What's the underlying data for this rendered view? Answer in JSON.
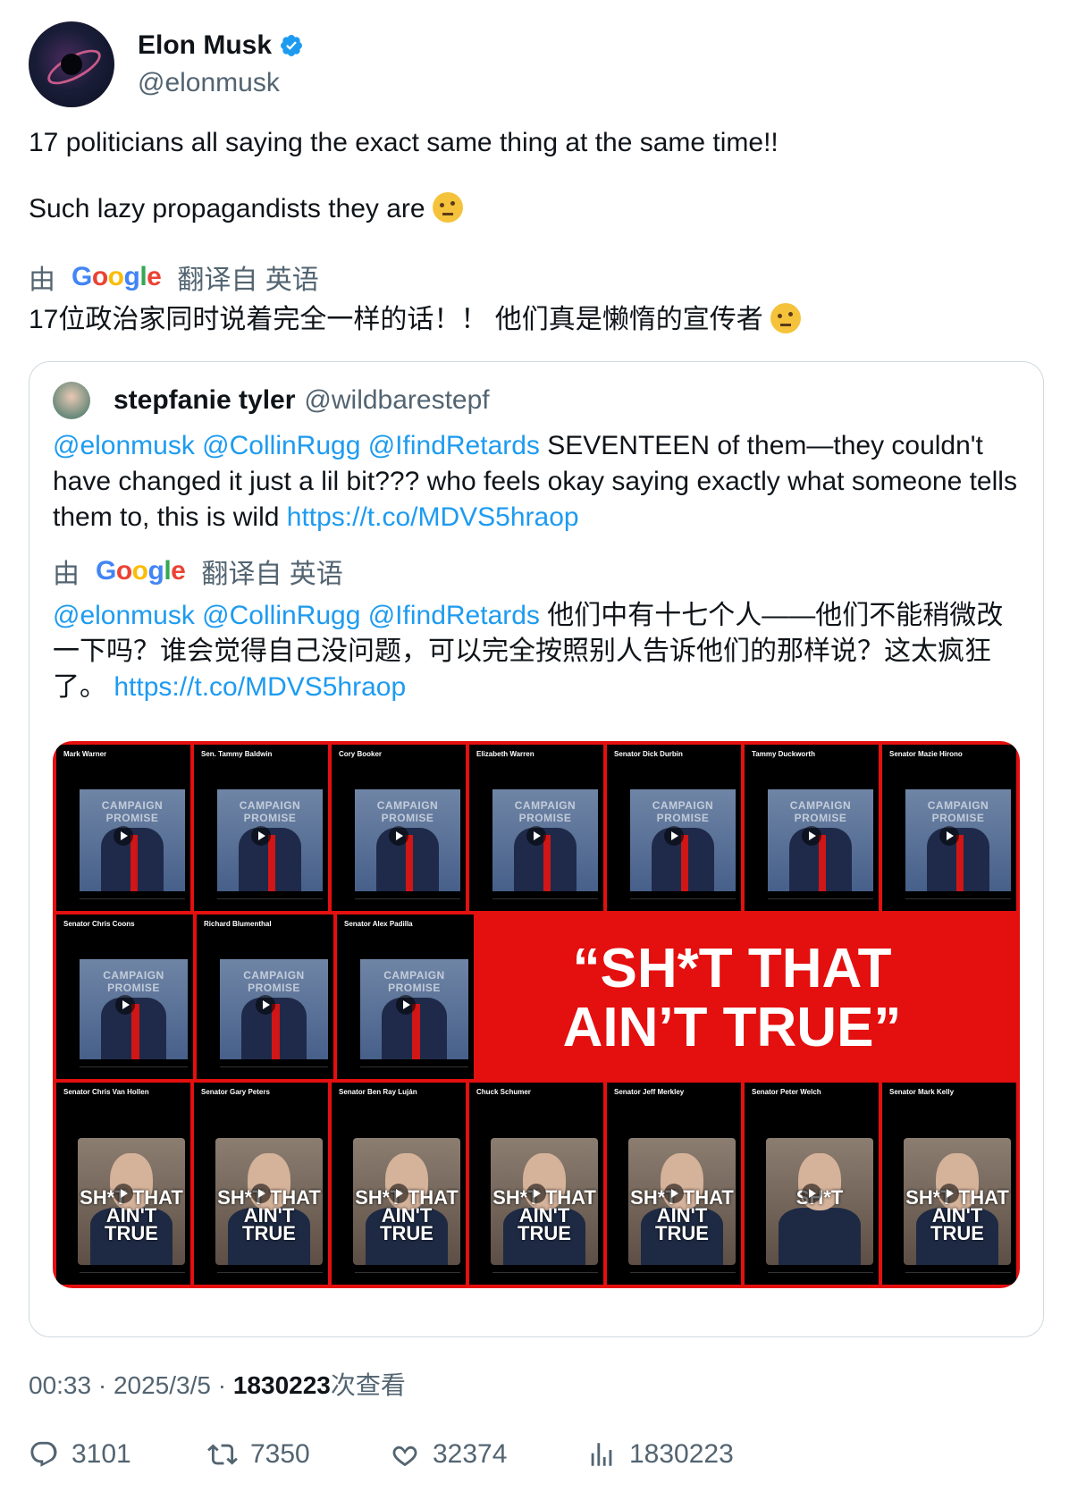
{
  "author": {
    "name": "Elon Musk",
    "handle": "@elonmusk"
  },
  "post": {
    "line1": "17 politicians all saying the exact same thing at the same time!!",
    "line2": "Such lazy propagandists they are",
    "translated_by": "由",
    "google": "Google",
    "translated_from": "翻译自 英语",
    "translation": "17位政治家同时说着完全一样的话！！ 他们真是懒惰的宣传者"
  },
  "quote": {
    "name": "stepfanie tyler",
    "handle": "@wildbarestepf",
    "mentions": "@elonmusk @CollinRugg @IfindRetards",
    "text": "SEVENTEEN of them—they couldn't have changed it just a lil bit??? who feels okay saying exactly what someone tells them to, this is wild",
    "link": "https://t.co/MDVS5hraop",
    "translated_by": "由",
    "google": "Google",
    "translated_from": "翻译自 英语",
    "translation": "他们中有十七个人——他们不能稍微改一下吗？谁会觉得自己没问题，可以完全按照别人告诉他们的那样说？这太疯狂了。",
    "media": {
      "headline_line1": "“SH*T THAT",
      "headline_line2": "AIN’T TRUE”",
      "row1": [
        {
          "name": "Mark Warner",
          "stamp": "CAMPAIGN PROMISE"
        },
        {
          "name": "Sen. Tammy Baldwin",
          "stamp": "CAMPAIGN PROMISE"
        },
        {
          "name": "Cory Booker",
          "stamp": "CAMPAIGN PROMISE"
        },
        {
          "name": "Elizabeth Warren",
          "stamp": "CAMPAIGN PROMISE"
        },
        {
          "name": "Senator Dick Durbin",
          "stamp": "CAMPAIGN PROMISE"
        },
        {
          "name": "Tammy Duckworth",
          "stamp": "CAMPAIGN PROMISE"
        },
        {
          "name": "Senator Mazie Hirono",
          "stamp": "CAMPAIGN PROMISE"
        }
      ],
      "row2": [
        {
          "name": "Senator Chris Coons",
          "stamp": "CAMPAIGN PROMISE"
        },
        {
          "name": "Richard Blumenthal",
          "stamp": "CAMPAIGN PROMISE"
        },
        {
          "name": "Senator Alex Padilla",
          "stamp": "CAMPAIGN PROMISE"
        }
      ],
      "row3": [
        {
          "name": "Senator Chris Van Hollen",
          "overlay": "SH*T THAT AIN'T TRUE"
        },
        {
          "name": "Senator Gary Peters",
          "overlay": "SH*T THAT AIN'T TRUE"
        },
        {
          "name": "Senator Ben Ray Luján",
          "overlay": "SH*T THAT AIN'T TRUE"
        },
        {
          "name": "Chuck Schumer",
          "overlay": "SH*T THAT AIN'T TRUE"
        },
        {
          "name": "Senator Jeff Merkley",
          "overlay": "SH*T THAT AIN'T TRUE"
        },
        {
          "name": "Senator Peter Welch",
          "overlay": "SH*T"
        },
        {
          "name": "Senator Mark Kelly",
          "overlay": "SH*T THAT AIN'T TRUE"
        }
      ]
    }
  },
  "meta": {
    "time": "00:33",
    "sep": " · ",
    "date": "2025/3/5",
    "views": "1830223",
    "views_label": "次查看"
  },
  "actions": {
    "replies": "3101",
    "reposts": "7350",
    "likes": "32374",
    "views": "1830223"
  },
  "colors": {
    "link": "#1d9bf0",
    "muted": "#536471",
    "media_bg": "#e40f0f",
    "verified": "#1d9bf0"
  }
}
